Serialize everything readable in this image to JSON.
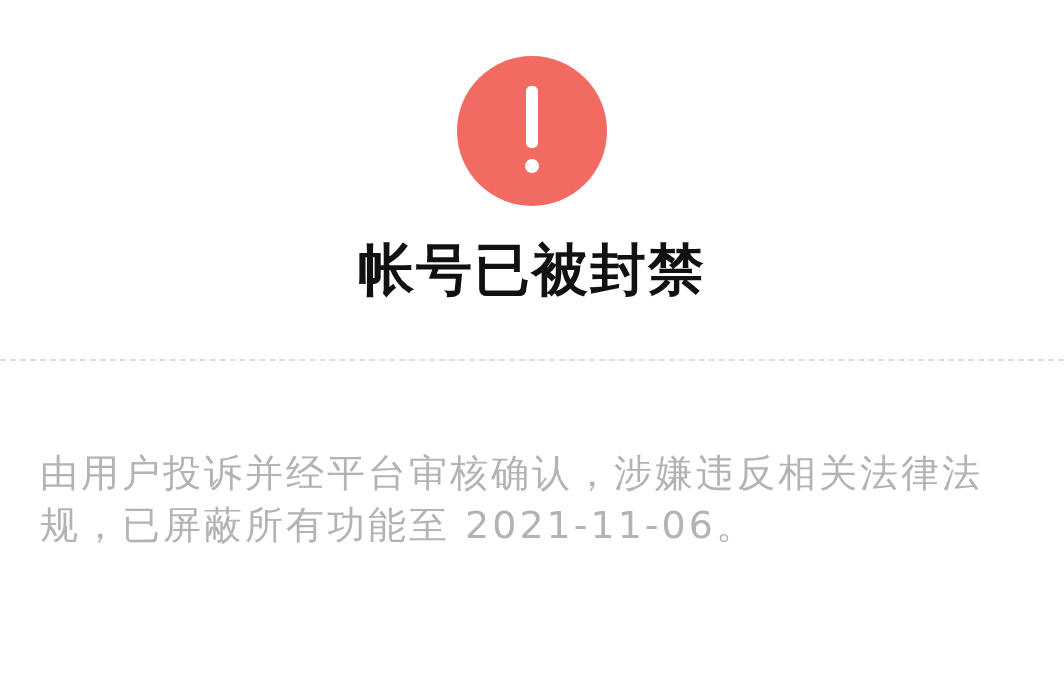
{
  "status": {
    "title": "帐号已被封禁",
    "message": "由用户投诉并经平台审核确认，涉嫌违反相关法律法规，已屏蔽所有功能至 2021-11-06。"
  }
}
